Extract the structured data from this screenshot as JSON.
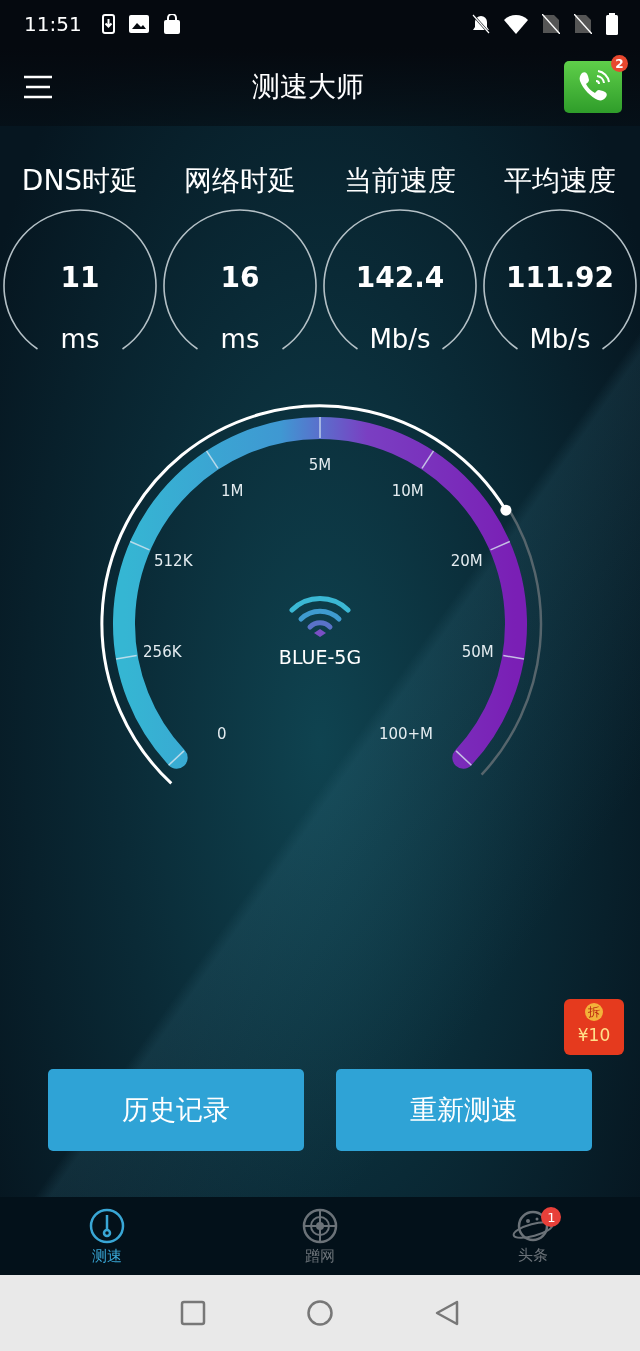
{
  "status_bar": {
    "time": "11:51"
  },
  "header": {
    "title": "测速大师",
    "call_badge": "2"
  },
  "stats": [
    {
      "label": "DNS时延",
      "value": "11",
      "unit": "ms"
    },
    {
      "label": "网络时延",
      "value": "16",
      "unit": "ms"
    },
    {
      "label": "当前速度",
      "value": "142.4",
      "unit": "Mb/s"
    },
    {
      "label": "平均速度",
      "value": "111.92",
      "unit": "Mb/s"
    }
  ],
  "gauge": {
    "scale": [
      "0",
      "256K",
      "512K",
      "1M",
      "5M",
      "10M",
      "20M",
      "50M",
      "100+M"
    ],
    "network": "BLUE-5G"
  },
  "promo": {
    "tag": "拆",
    "amount": "¥10"
  },
  "buttons": [
    "历史记录",
    "重新测速"
  ],
  "tabs": [
    {
      "label": "测速",
      "kind": "gauge",
      "selected": true
    },
    {
      "label": "蹭网",
      "kind": "target",
      "selected": false
    },
    {
      "label": "头条",
      "kind": "planet",
      "selected": false,
      "badge": "1"
    }
  ]
}
